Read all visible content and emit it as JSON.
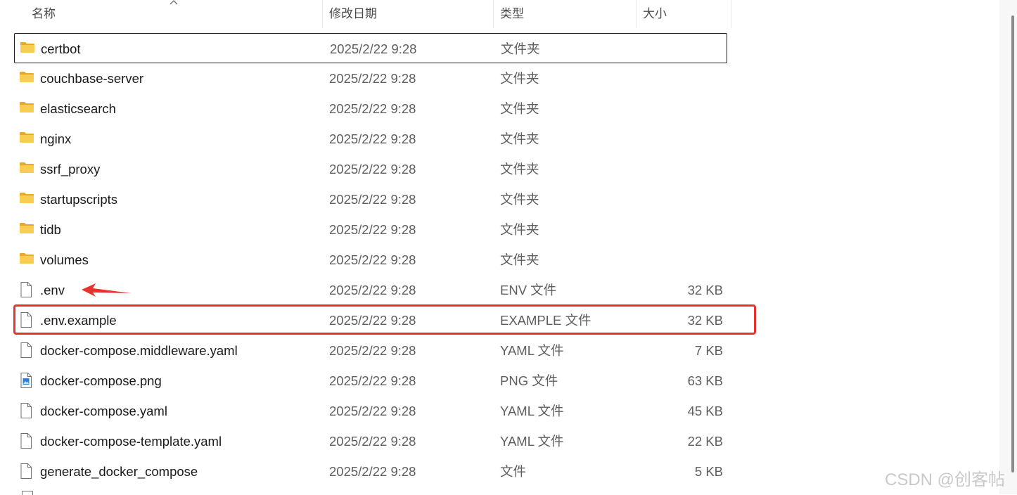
{
  "columns": {
    "name": "名称",
    "date": "修改日期",
    "type": "类型",
    "size": "大小"
  },
  "files": [
    {
      "name": "certbot",
      "date": "2025/2/22 9:28",
      "type": "文件夹",
      "size": "",
      "icon": "folder-icon",
      "focused": true
    },
    {
      "name": "couchbase-server",
      "date": "2025/2/22 9:28",
      "type": "文件夹",
      "size": "",
      "icon": "folder-icon"
    },
    {
      "name": "elasticsearch",
      "date": "2025/2/22 9:28",
      "type": "文件夹",
      "size": "",
      "icon": "folder-icon"
    },
    {
      "name": "nginx",
      "date": "2025/2/22 9:28",
      "type": "文件夹",
      "size": "",
      "icon": "folder-icon"
    },
    {
      "name": "ssrf_proxy",
      "date": "2025/2/22 9:28",
      "type": "文件夹",
      "size": "",
      "icon": "folder-icon"
    },
    {
      "name": "startupscripts",
      "date": "2025/2/22 9:28",
      "type": "文件夹",
      "size": "",
      "icon": "folder-icon"
    },
    {
      "name": "tidb",
      "date": "2025/2/22 9:28",
      "type": "文件夹",
      "size": "",
      "icon": "folder-icon"
    },
    {
      "name": "volumes",
      "date": "2025/2/22 9:28",
      "type": "文件夹",
      "size": "",
      "icon": "folder-icon"
    },
    {
      "name": ".env",
      "date": "2025/2/22 9:28",
      "type": "ENV 文件",
      "size": "32 KB",
      "icon": "file-icon",
      "arrow": true
    },
    {
      "name": ".env.example",
      "date": "2025/2/22 9:28",
      "type": "EXAMPLE 文件",
      "size": "32 KB",
      "icon": "file-icon",
      "highlighted": true
    },
    {
      "name": "docker-compose.middleware.yaml",
      "date": "2025/2/22 9:28",
      "type": "YAML 文件",
      "size": "7 KB",
      "icon": "file-icon"
    },
    {
      "name": "docker-compose.png",
      "date": "2025/2/22 9:28",
      "type": "PNG 文件",
      "size": "63 KB",
      "icon": "image-file-icon"
    },
    {
      "name": "docker-compose.yaml",
      "date": "2025/2/22 9:28",
      "type": "YAML 文件",
      "size": "45 KB",
      "icon": "file-icon"
    },
    {
      "name": "docker-compose-template.yaml",
      "date": "2025/2/22 9:28",
      "type": "YAML 文件",
      "size": "22 KB",
      "icon": "file-icon"
    },
    {
      "name": "generate_docker_compose",
      "date": "2025/2/22 9:28",
      "type": "文件",
      "size": "5 KB",
      "icon": "file-icon"
    }
  ],
  "watermark": "CSDN @创客帖",
  "colors": {
    "highlight_border": "#e8332c",
    "arrow": "#e8332c",
    "folder_body": "#f8cd52",
    "folder_tab": "#e6a92a",
    "text_secondary": "#5e5e5e"
  }
}
